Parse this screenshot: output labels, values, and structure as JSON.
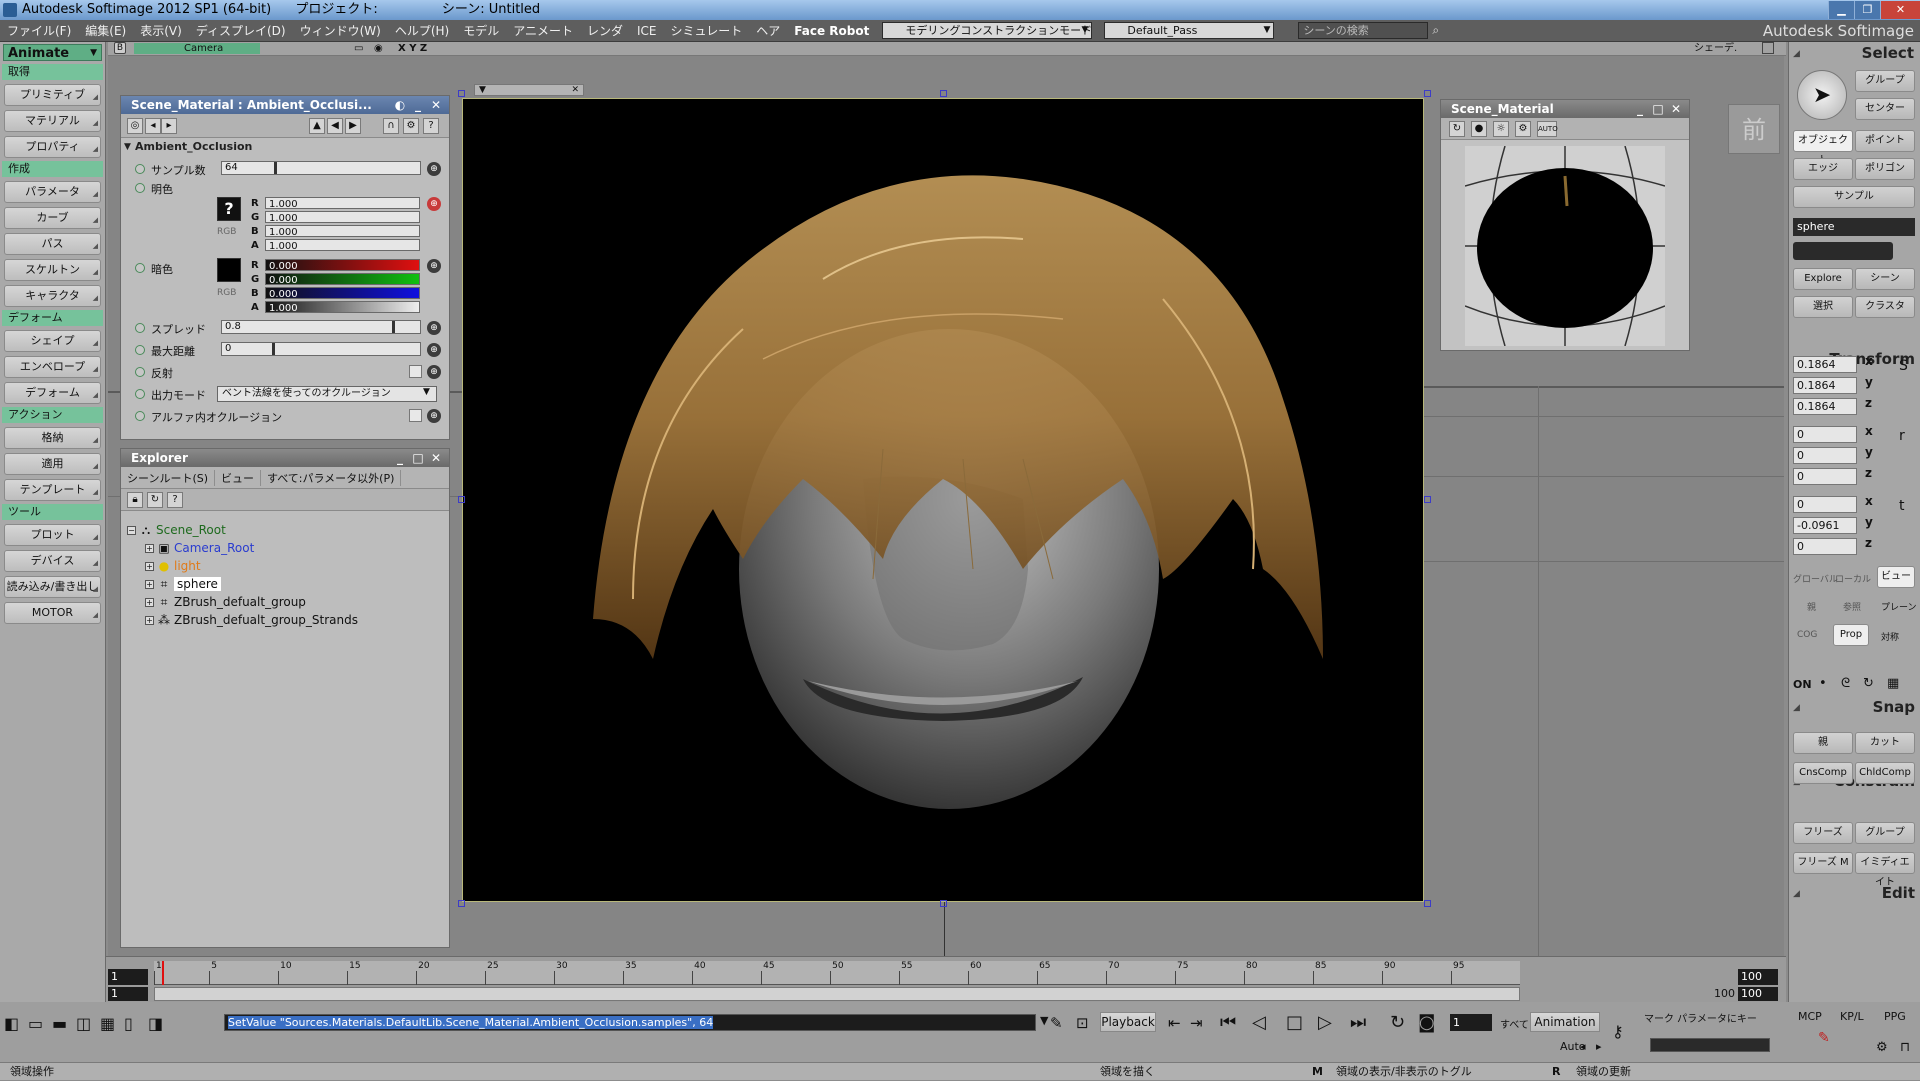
{
  "window": {
    "title": "Autodesk Softimage 2012 SP1 (64-bit)",
    "project_label": "プロジェクト:",
    "scene_label": "シーン: Untitled"
  },
  "menu": {
    "items": [
      "ファイル(F)",
      "編集(E)",
      "表示(V)",
      "ディスプレイ(D)",
      "ウィンドウ(W)",
      "ヘルプ(H)",
      "モデル",
      "アニメート",
      "レンダ",
      "ICE",
      "シミュレート",
      "ヘア",
      "Face Robot"
    ],
    "mode_combo": "モデリングコンストラクションモード",
    "pass_combo": "Default_Pass",
    "search_placeholder": "シーンの検索",
    "brand": "Autodesk Softimage"
  },
  "left_toolbar": {
    "module": "Animate",
    "sections": [
      {
        "title": "取得",
        "buttons": [
          "プリミティブ",
          "マテリアル",
          "プロパティ"
        ]
      },
      {
        "title": "作成",
        "buttons": [
          "パラメータ",
          "カーブ",
          "パス",
          "スケルトン",
          "キャラクタ"
        ]
      },
      {
        "title": "デフォーム",
        "buttons": [
          "シェイプ",
          "エンベロープ",
          "デフォーム"
        ]
      },
      {
        "title": "アクション",
        "buttons": [
          "格納",
          "適用",
          "テンプレート"
        ]
      },
      {
        "title": "ツール",
        "buttons": [
          "プロット",
          "デバイス",
          "読み込み/書き出し",
          "MOTOR"
        ]
      }
    ]
  },
  "viewport": {
    "camera_label": "Camera",
    "axes_label": "X Y Z",
    "shading_label": "シェーデ.",
    "front_label": "前"
  },
  "material_panel": {
    "title": "Scene_Material : Ambient_Occlusi...",
    "section": "Ambient_Occlusion",
    "samples_label": "サンプル数",
    "samples_value": "64",
    "bright_label": "明色",
    "bright_rgba": {
      "R": "1.000",
      "G": "1.000",
      "B": "1.000",
      "A": "1.000"
    },
    "dark_label": "暗色",
    "dark_rgba": {
      "R": "0.000",
      "G": "0.000",
      "B": "0.000",
      "A": "1.000"
    },
    "rgb_label": "RGB",
    "spread_label": "スプレッド",
    "spread_value": "0.8",
    "maxdist_label": "最大距離",
    "maxdist_value": "0",
    "reflect_label": "反射",
    "output_label": "出力モード",
    "output_value": "ベント法線を使ってのオクルージョン",
    "alpha_label": "アルファ内オクルージョン"
  },
  "explorer": {
    "title": "Explorer",
    "menu": [
      "シーンルート(S)",
      "ビュー",
      "すべて:パラメータ以外(P)"
    ],
    "nodes": [
      {
        "label": "Scene_Root",
        "color": "#1e6a1e",
        "icon": "scene-root-icon"
      },
      {
        "label": "Camera_Root",
        "color": "#2a3ccf",
        "icon": "camera-icon"
      },
      {
        "label": "light",
        "color": "#e07a18",
        "icon": "light-icon"
      },
      {
        "label": "sphere",
        "color": "#111111",
        "icon": "mesh-icon"
      },
      {
        "label": "ZBrush_defualt_group",
        "color": "#111111",
        "icon": "group-icon"
      },
      {
        "label": "ZBrush_defualt_group_Strands",
        "color": "#111111",
        "icon": "strands-icon"
      }
    ]
  },
  "scene_material_preview": {
    "title": "Scene_Material",
    "auto_label": "AUTO"
  },
  "right_panel": {
    "select_title": "Select",
    "select_buttons": [
      "グループ",
      "センター",
      "オブジェクト",
      "ポイント",
      "エッジ",
      "ポリゴン",
      "サンプル"
    ],
    "selected_object": "sphere",
    "explore_buttons": [
      "Explore",
      "シーン",
      "選択",
      "クラスタ"
    ],
    "transform_title": "Transform",
    "scale": [
      "0.1864",
      "0.1864",
      "0.1864"
    ],
    "rotation": [
      "0",
      "0",
      "0"
    ],
    "translation": [
      "0",
      "-0.0961",
      "0"
    ],
    "axes": [
      "x",
      "y",
      "z"
    ],
    "space_buttons": [
      "グローバル",
      "ローカル",
      "ビュー",
      "親",
      "参照",
      "プレーン",
      "COG",
      "Prop",
      "対称"
    ],
    "snap_title": "Snap",
    "snap_on": "ON",
    "constrain_title": "Constrain",
    "constrain_buttons": [
      "親",
      "カット",
      "CnsComp",
      "ChldComp"
    ],
    "edit_title": "Edit",
    "edit_buttons": [
      "フリーズ",
      "グループ",
      "フリーズ M",
      "イミディエイト"
    ]
  },
  "timeline": {
    "start": "1",
    "current": "1",
    "end": "100",
    "end2": "100",
    "ticks": [
      "1",
      "5",
      "10",
      "15",
      "20",
      "25",
      "30",
      "35",
      "40",
      "45",
      "50",
      "55",
      "60",
      "65",
      "70",
      "75",
      "80",
      "85",
      "90",
      "95"
    ],
    "range_end": "100"
  },
  "bottom": {
    "command": "SetValue \"Sources.Materials.DefaultLib.Scene_Material.Ambient_Occlusion.samples\", 64",
    "playback_label": "Playback",
    "frame_value": "1",
    "all_label": "すべて",
    "animation_label": "Animation",
    "auto_label": "Auto",
    "marker_label": "マーク パラメータにキー",
    "tabs": [
      "MCP",
      "KP/L",
      "PPG"
    ],
    "status_left": "領域操作",
    "status_mid1": "領域を描く",
    "status_mid2": "領域の表示/非表示のトグル",
    "status_right": "領域の更新",
    "m_key": "M",
    "r_key": "R"
  }
}
